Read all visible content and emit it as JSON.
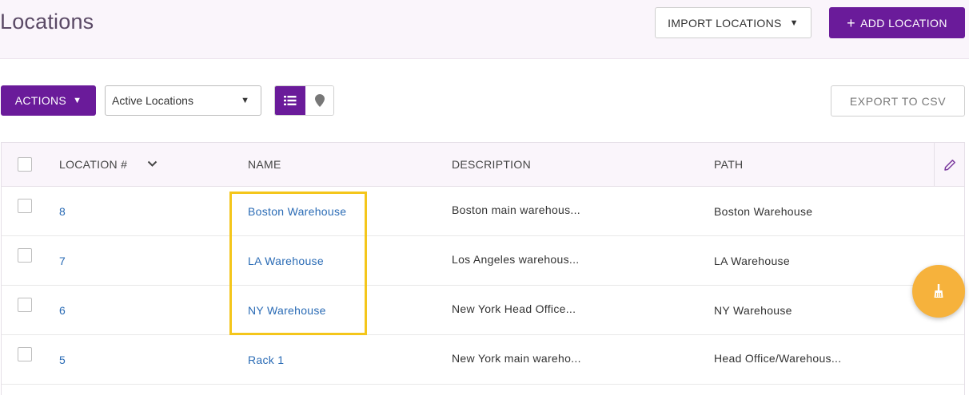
{
  "header": {
    "title": "Locations",
    "import_label": "IMPORT LOCATIONS",
    "add_label": "ADD LOCATION",
    "add_plus": "+"
  },
  "toolbar": {
    "actions_label": "ACTIONS",
    "filter_value": "Active Locations",
    "export_label": "EXPORT TO CSV"
  },
  "table": {
    "columns": [
      "LOCATION #",
      "NAME",
      "DESCRIPTION",
      "PATH"
    ],
    "rows": [
      {
        "number": "8",
        "name": "Boston Warehouse",
        "description": "Boston main warehous...",
        "path": "Boston Warehouse"
      },
      {
        "number": "7",
        "name": "LA Warehouse",
        "description": "Los Angeles warehous...",
        "path": "LA Warehouse"
      },
      {
        "number": "6",
        "name": "NY Warehouse",
        "description": "New York Head Office...",
        "path": "NY Warehouse"
      },
      {
        "number": "5",
        "name": "Rack 1",
        "description": "New York main wareho...",
        "path": "Head Office/Warehous..."
      }
    ]
  },
  "colors": {
    "accent": "#6a1b9a",
    "link": "#2a6bb5",
    "highlight": "#f4c61b",
    "fab": "#f6b23c"
  },
  "icons": {
    "caret": "caret-down-icon",
    "list_view": "list-icon",
    "map_view": "map-pin-icon",
    "sort": "chevron-down-icon",
    "edit": "pencil-icon",
    "fab": "broom-icon"
  }
}
